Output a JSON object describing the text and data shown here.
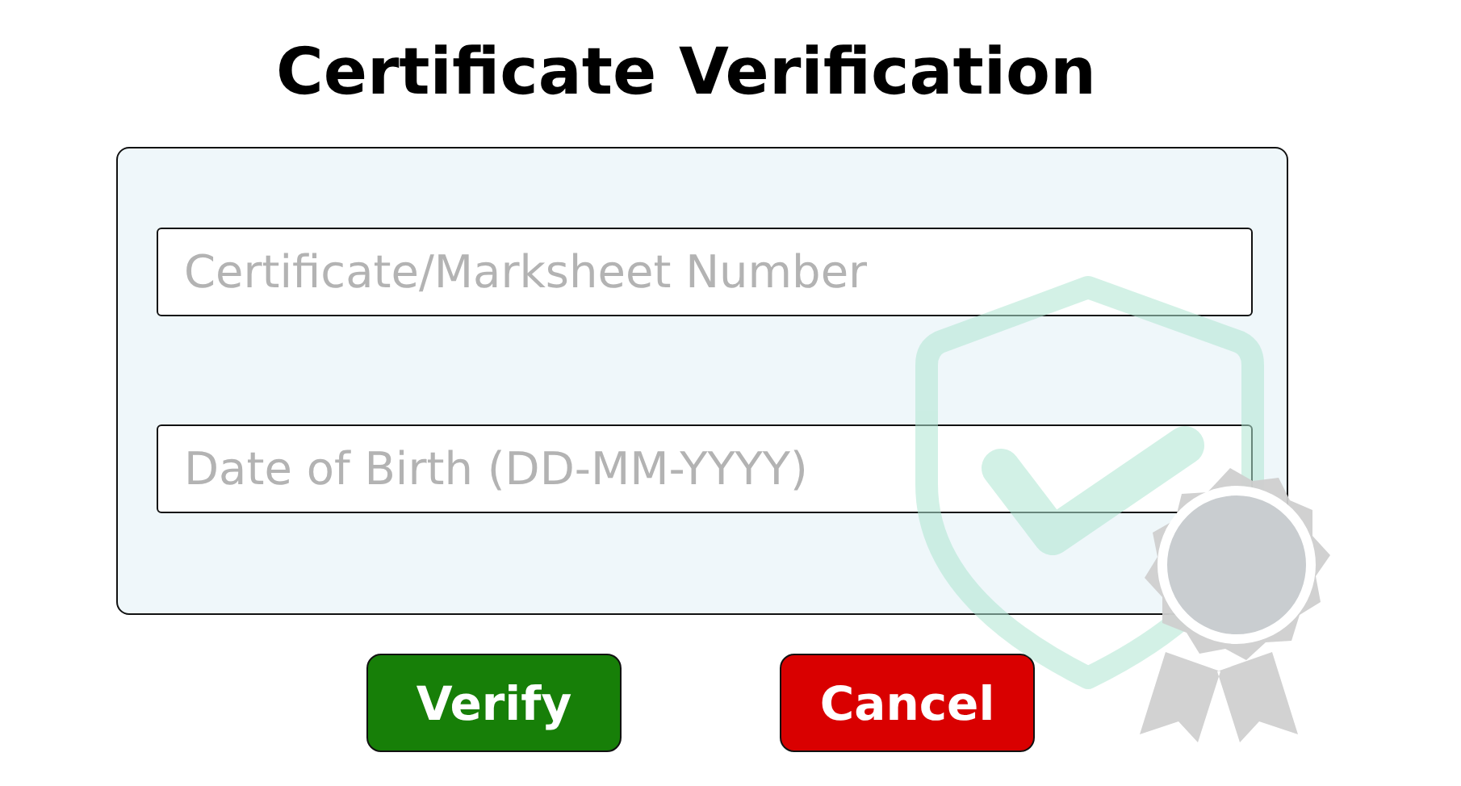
{
  "title": "Certificate Verification",
  "fields": [
    {
      "placeholder": "Certificate/Marksheet Number"
    },
    {
      "placeholder": "Date of Birth (DD-MM-YYYY)"
    }
  ],
  "buttons": [
    {
      "label": "Verify",
      "color": "#177f08"
    },
    {
      "label": "Cancel",
      "color": "#d90000"
    }
  ]
}
